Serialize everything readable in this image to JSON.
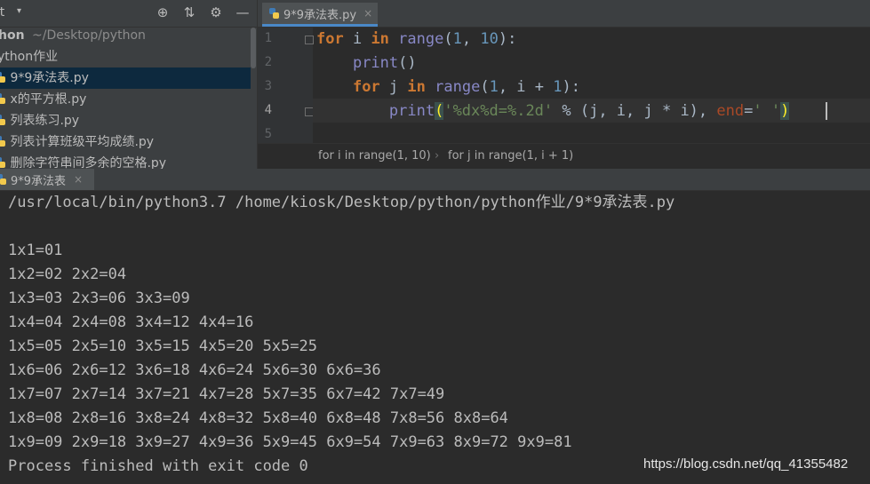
{
  "project": {
    "header_title": "ct",
    "root_name": "hon",
    "root_path": "~/Desktop/python",
    "folder_name": "ython作业",
    "files": [
      "9*9承法表.py",
      "x的平方根.py",
      "列表练习.py",
      "列表计算班级平均成绩.py",
      "删除字符串间多余的空格.py"
    ]
  },
  "editor": {
    "tab_label": "9*9承法表.py",
    "line_numbers": [
      "1",
      "2",
      "3",
      "4",
      "5"
    ],
    "breadcrumb": [
      "for i in range(1, 10)",
      "for j in range(1, i + 1)"
    ]
  },
  "run": {
    "tab_label": "9*9承法表",
    "console_lines": [
      "/usr/local/bin/python3.7 /home/kiosk/Desktop/python/python作业/9*9承法表.py",
      "",
      "1x1=01",
      "1x2=02 2x2=04",
      "1x3=03 2x3=06 3x3=09",
      "1x4=04 2x4=08 3x4=12 4x4=16",
      "1x5=05 2x5=10 3x5=15 4x5=20 5x5=25",
      "1x6=06 2x6=12 3x6=18 4x6=24 5x6=30 6x6=36",
      "1x7=07 2x7=14 3x7=21 4x7=28 5x7=35 6x7=42 7x7=49",
      "1x8=08 2x8=16 3x8=24 4x8=32 5x8=40 6x8=48 7x8=56 8x8=64",
      "1x9=09 2x9=18 3x9=27 4x9=36 5x9=45 6x9=54 7x9=63 8x9=72 9x9=81",
      "Process finished with exit code 0"
    ]
  },
  "watermark": "https://blog.csdn.net/qq_41355482",
  "icons": {
    "caret": "▾",
    "target": "⊕",
    "collapse": "⇅",
    "gear": "⚙",
    "minimize": "—",
    "close": "×"
  }
}
